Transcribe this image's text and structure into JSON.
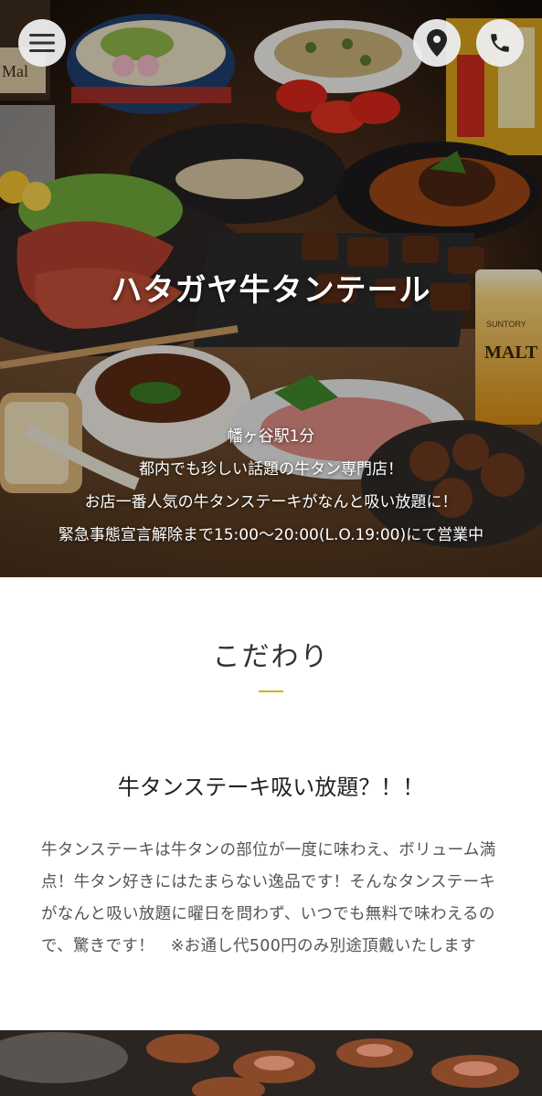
{
  "hero": {
    "title": "ハタガヤ牛タンテール",
    "lines": [
      "幡ヶ谷駅1分",
      "都内でも珍しい話題の牛タン専門店！",
      "お店一番人気の牛タンステーキがなんと吸い放題に！",
      "緊急事態宣言解除まで15:00～20:00(L.O.19:00)にて営業中"
    ],
    "photo_signs": {
      "left_bottle": "Mal",
      "beer_brand": "MALT",
      "beer_maker": "SUNTORY"
    }
  },
  "icons": {
    "menu": "hamburger-menu-icon",
    "map": "map-pin-icon",
    "phone": "phone-icon"
  },
  "section": {
    "title": "こだわり",
    "accent_color": "#e0a92a"
  },
  "feature": {
    "heading": "牛タンステーキ吸い放題？！！",
    "body": "牛タンステーキは牛タンの部位が一度に味わえ、ボリューム満点！牛タン好きにはたまらない逸品です！そんなタンステーキがなんと吸い放題に曜日を問わず、いつでも無料で味わえるので、驚きです！　※お通し代500円のみ別途頂戴いたします"
  }
}
